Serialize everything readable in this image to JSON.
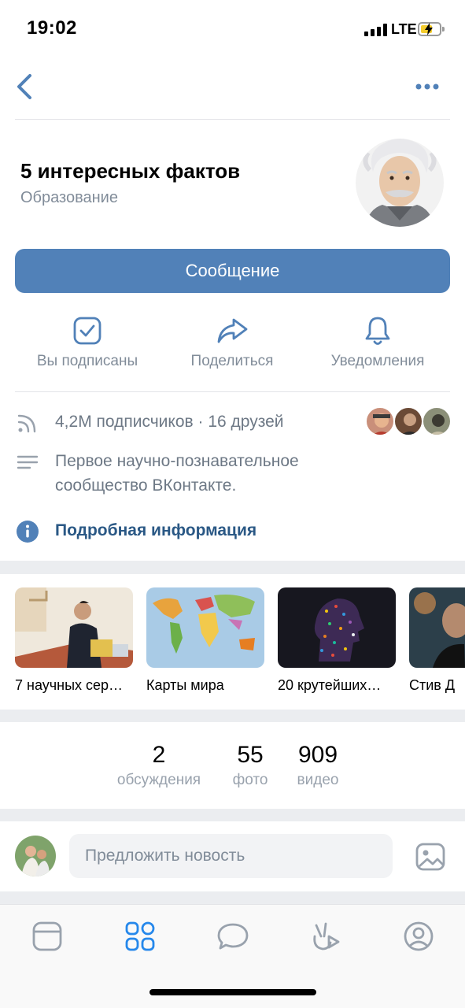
{
  "status": {
    "time": "19:02",
    "network": "LTE"
  },
  "group": {
    "title": "5 интересных фактов",
    "category": "Образование",
    "message_button": "Сообщение"
  },
  "actions": [
    {
      "label": "Вы подписаны",
      "icon": "check-square-icon"
    },
    {
      "label": "Поделиться",
      "icon": "share-arrow-icon"
    },
    {
      "label": "Уведомления",
      "icon": "bell-icon"
    }
  ],
  "info": {
    "subscribers": "4,2M подписчиков · 16 друзей",
    "description": [
      "Первое научно-познавательное",
      "сообщество ВКонтакте."
    ],
    "more_link": "Подробная информация"
  },
  "albums": [
    {
      "caption": "7 научных сер…"
    },
    {
      "caption": "Карты мира"
    },
    {
      "caption": "20 крутейших…"
    },
    {
      "caption": "Стив Д"
    }
  ],
  "counters": [
    {
      "value": "2",
      "label": "обсуждения"
    },
    {
      "value": "55",
      "label": "фото"
    },
    {
      "value": "909",
      "label": "видео"
    }
  ],
  "suggest": {
    "placeholder": "Предложить новость"
  },
  "tabbar": [
    "news-feed-icon",
    "services-icon",
    "messages-icon",
    "clips-icon",
    "profile-icon"
  ],
  "colors": {
    "accent": "#5181b8",
    "link": "#2a5885",
    "secondary_text": "#818c99",
    "icon": "#99a2ad",
    "active_tab": "#2688eb"
  }
}
